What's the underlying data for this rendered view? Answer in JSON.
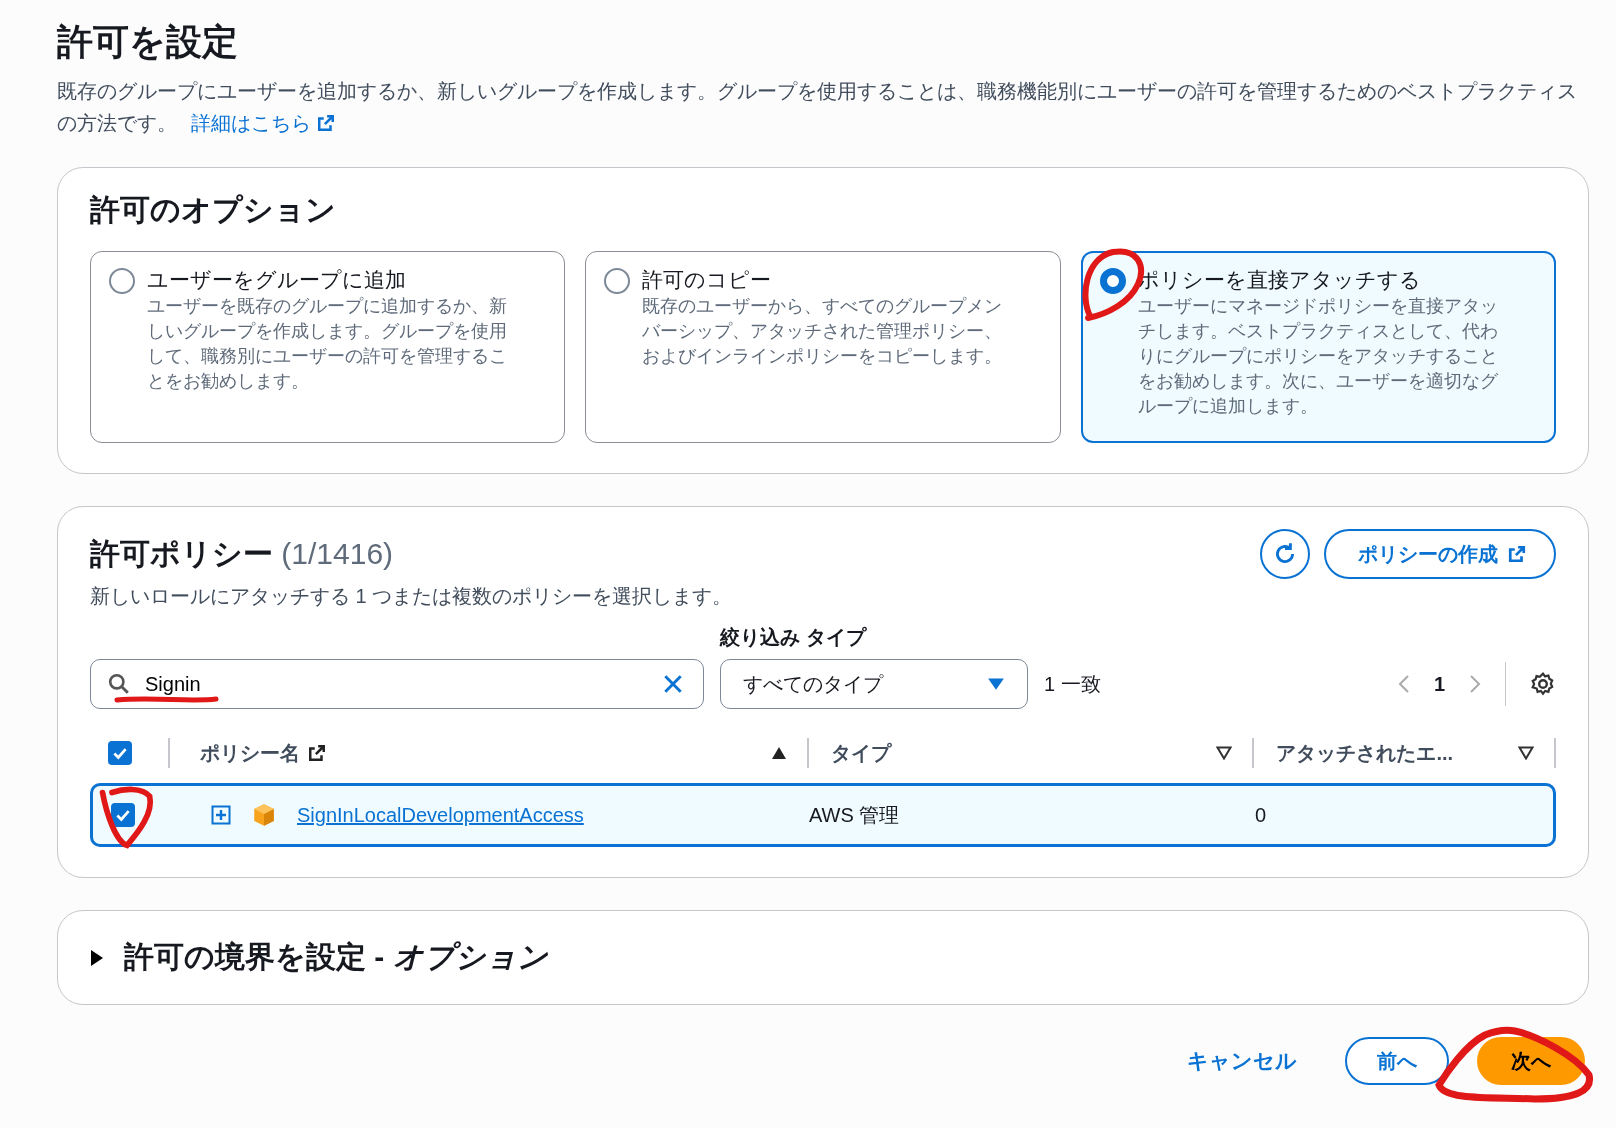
{
  "page": {
    "title": "許可を設定",
    "description": "既存のグループにユーザーを追加するか、新しいグループを作成します。グループを使用することは、職務機能別にユーザーの許可を管理するためのベストプラクティスの方法です。",
    "link": "詳細はこちら"
  },
  "options_panel": {
    "title": "許可のオプション",
    "options": [
      {
        "title": "ユーザーをグループに追加",
        "description": "ユーザーを既存のグループに追加するか、新しいグループを作成します。グループを使用して、職務別にユーザーの許可を管理することをお勧めします。",
        "selected": false
      },
      {
        "title": "許可のコピー",
        "description": "既存のユーザーから、すべてのグループメンバーシップ、アタッチされた管理ポリシー、およびインラインポリシーをコピーします。",
        "selected": false
      },
      {
        "title": "ポリシーを直接アタッチする",
        "description": "ユーザーにマネージドポリシーを直接アタッチします。ベストプラクティスとして、代わりにグループにポリシーをアタッチすることをお勧めします。次に、ユーザーを適切なグループに追加します。",
        "selected": true
      }
    ]
  },
  "policies_panel": {
    "title": "許可ポリシー",
    "count": "(1/1416)",
    "create_button": "ポリシーの作成",
    "subtitle": "新しいロールにアタッチする 1 つまたは複数のポリシーを選択します。",
    "search": {
      "value": "Signin"
    },
    "filter": {
      "label": "絞り込み タイプ",
      "value": "すべてのタイプ"
    },
    "match_count": "1 一致",
    "page": "1",
    "table": {
      "select_all_checked": true,
      "columns": [
        {
          "label": "ポリシー名",
          "sorted": true,
          "external": true
        },
        {
          "label": "タイプ",
          "sorted": false,
          "external": false
        },
        {
          "label": "アタッチされたエ...",
          "sorted": false,
          "external": false
        }
      ],
      "rows": [
        {
          "name": "SignInLocalDevelopmentAccess",
          "type": "AWS 管理",
          "attached": "0",
          "checked": true,
          "selected": true
        }
      ]
    }
  },
  "boundary_panel": {
    "title": "許可の境界を設定 - *オプション*",
    "expanded": false
  },
  "footer": {
    "cancel": "キャンセル",
    "previous": "前へ",
    "next": "次へ"
  }
}
